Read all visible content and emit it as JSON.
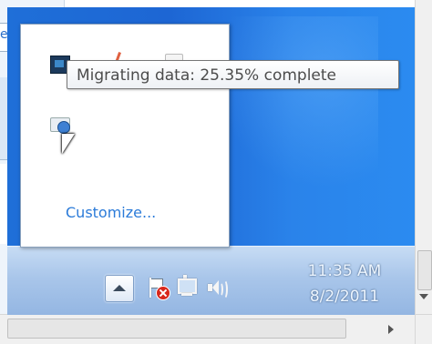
{
  "left_pane": {
    "link_text": "e"
  },
  "popup": {
    "icons": [
      "migration-icon",
      "power-icon",
      "blank-icon",
      "usb-icon"
    ],
    "customize_label": "Customize..."
  },
  "tooltip": {
    "text": "Migrating data: 25.35% complete"
  },
  "taskbar": {
    "clock_time": "11:35 AM",
    "clock_date": "8/2/2011",
    "icons": [
      "show-hidden-icons-button",
      "action-center-flag-icon",
      "network-icon",
      "volume-icon"
    ]
  },
  "colors": {
    "desktop": "#1f6fd8",
    "link": "#2b7bd9",
    "taskbar": "#a9c6ea"
  }
}
